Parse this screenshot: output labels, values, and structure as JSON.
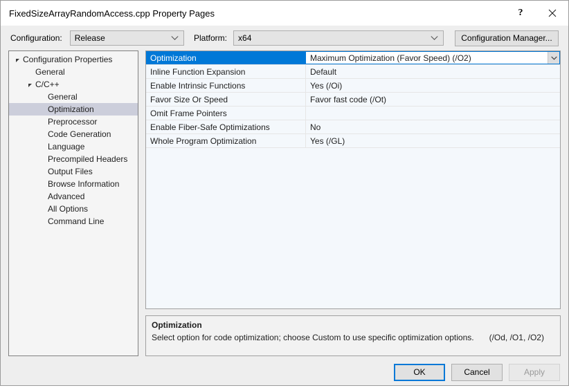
{
  "window": {
    "title": "FixedSizeArrayRandomAccess.cpp Property Pages",
    "help_icon": "?",
    "close_icon": "close-icon"
  },
  "configbar": {
    "configuration_label": "Configuration:",
    "configuration_value": "Release",
    "platform_label": "Platform:",
    "platform_value": "x64",
    "configuration_manager_label": "Configuration Manager..."
  },
  "tree": {
    "items": [
      {
        "label": "Configuration Properties",
        "indent": 0,
        "expander": "expanded",
        "selected": false
      },
      {
        "label": "General",
        "indent": 1,
        "expander": "none",
        "selected": false
      },
      {
        "label": "C/C++",
        "indent": 1,
        "expander": "expanded",
        "selected": false
      },
      {
        "label": "General",
        "indent": 2,
        "expander": "none",
        "selected": false
      },
      {
        "label": "Optimization",
        "indent": 2,
        "expander": "none",
        "selected": true
      },
      {
        "label": "Preprocessor",
        "indent": 2,
        "expander": "none",
        "selected": false
      },
      {
        "label": "Code Generation",
        "indent": 2,
        "expander": "none",
        "selected": false
      },
      {
        "label": "Language",
        "indent": 2,
        "expander": "none",
        "selected": false
      },
      {
        "label": "Precompiled Headers",
        "indent": 2,
        "expander": "none",
        "selected": false
      },
      {
        "label": "Output Files",
        "indent": 2,
        "expander": "none",
        "selected": false
      },
      {
        "label": "Browse Information",
        "indent": 2,
        "expander": "none",
        "selected": false
      },
      {
        "label": "Advanced",
        "indent": 2,
        "expander": "none",
        "selected": false
      },
      {
        "label": "All Options",
        "indent": 2,
        "expander": "none",
        "selected": false
      },
      {
        "label": "Command Line",
        "indent": 2,
        "expander": "none",
        "selected": false
      }
    ]
  },
  "grid": {
    "rows": [
      {
        "name": "Optimization",
        "value": "Maximum Optimization (Favor Speed) (/O2)",
        "selected": true,
        "dropdown": true
      },
      {
        "name": "Inline Function Expansion",
        "value": "Default",
        "selected": false,
        "dropdown": false
      },
      {
        "name": "Enable Intrinsic Functions",
        "value": "Yes (/Oi)",
        "selected": false,
        "dropdown": false
      },
      {
        "name": "Favor Size Or Speed",
        "value": "Favor fast code (/Ot)",
        "selected": false,
        "dropdown": false
      },
      {
        "name": "Omit Frame Pointers",
        "value": "",
        "selected": false,
        "dropdown": false
      },
      {
        "name": "Enable Fiber-Safe Optimizations",
        "value": "No",
        "selected": false,
        "dropdown": false
      },
      {
        "name": "Whole Program Optimization",
        "value": "Yes (/GL)",
        "selected": false,
        "dropdown": false
      }
    ]
  },
  "description": {
    "title": "Optimization",
    "text": "Select option for code optimization; choose Custom to use specific optimization options.",
    "flags": "(/Od, /O1, /O2)"
  },
  "footer": {
    "ok_label": "OK",
    "cancel_label": "Cancel",
    "apply_label": "Apply"
  },
  "colors": {
    "accent": "#0078d7",
    "tree_selection": "#cccedb",
    "dialog_bg": "#eeeeee",
    "grid_bg": "#f4f8fc"
  }
}
